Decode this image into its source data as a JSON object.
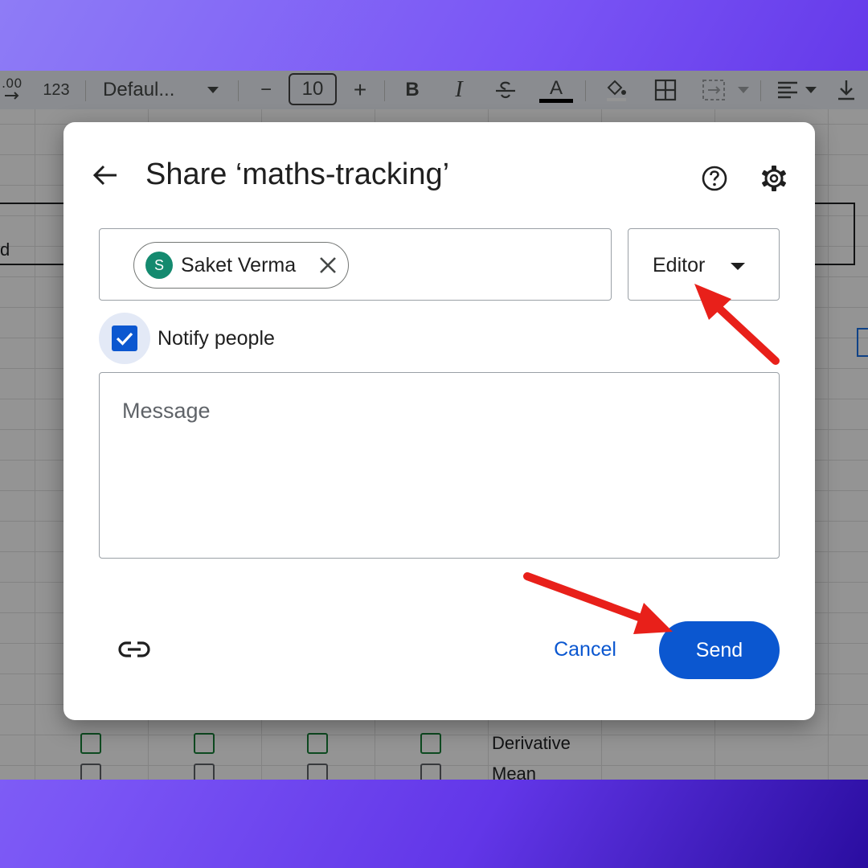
{
  "toolbar": {
    "more_formats_label": "123",
    "font_family": "Defaul...",
    "font_size": "10",
    "decrease_label": "−",
    "increase_label": "+",
    "bold_label": "B",
    "italic_label": "I",
    "text_color_label": "A"
  },
  "sheet": {
    "cells": [
      "d",
      "Derivative",
      "Mean"
    ]
  },
  "dialog": {
    "title": "Share ‘maths-tracking’",
    "recipient": {
      "initial": "S",
      "name": "Saket Verma",
      "avatar_color": "#148a6f"
    },
    "role": "Editor",
    "notify_label": "Notify people",
    "notify_checked": true,
    "message_placeholder": "Message",
    "cancel_label": "Cancel",
    "send_label": "Send",
    "accent_color": "#0b57d0"
  },
  "annotations": {
    "arrow_color": "#e8201a",
    "arrows": [
      "points-to-editor-role",
      "points-to-send-button"
    ]
  }
}
